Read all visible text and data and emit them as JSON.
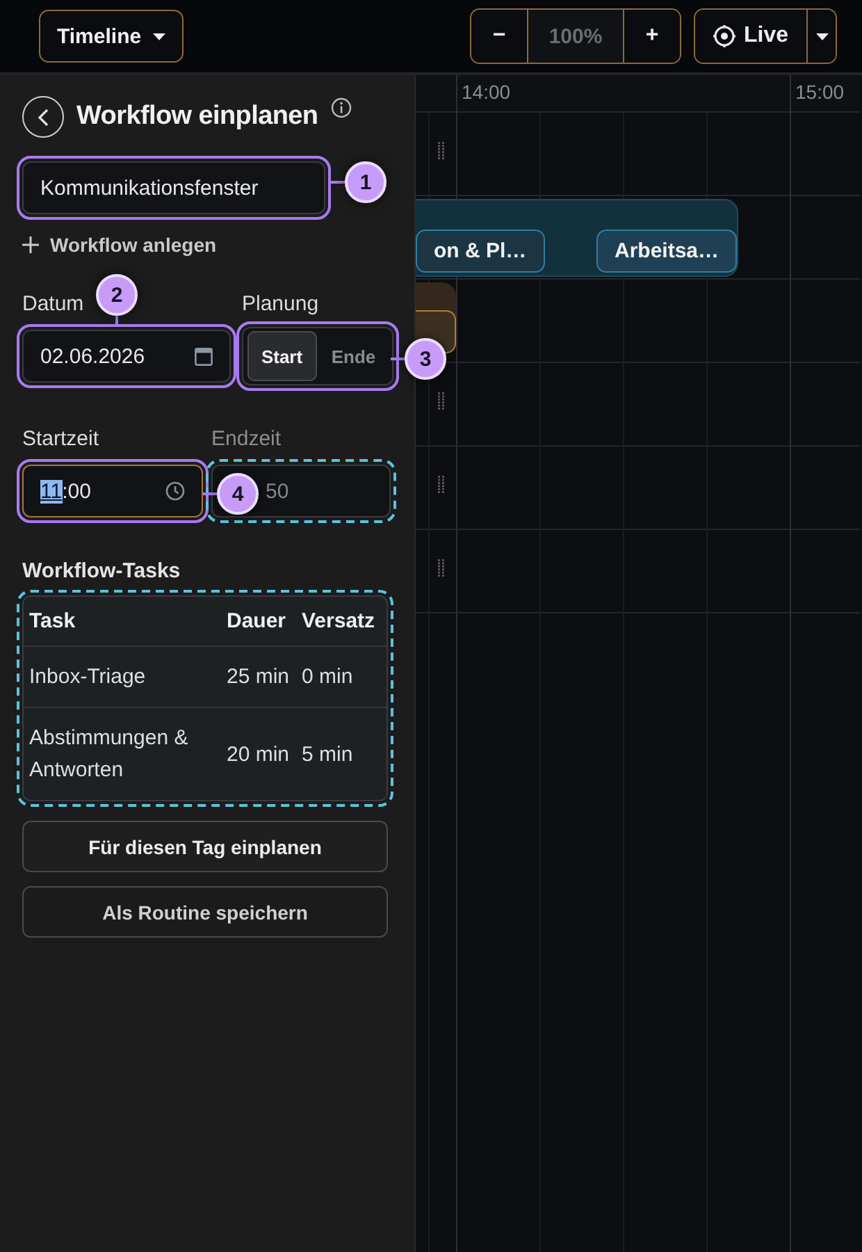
{
  "toolbar": {
    "view_menu": "Timeline",
    "zoom_out": "−",
    "zoom_level": "100%",
    "zoom_in": "+",
    "live_button": "Live"
  },
  "timeline": {
    "hours": [
      "14:00",
      "15:00"
    ],
    "events": [
      {
        "label": "on & Pl…",
        "color": "#2f7ea3"
      },
      {
        "label": "Arbeitsa…",
        "color": "#2f7ea3"
      },
      {
        "color": "#b27a3a"
      }
    ]
  },
  "panel": {
    "title": "Workflow einplanen",
    "workflow_select": {
      "value": "Kommunikationsfenster"
    },
    "add_workflow": "Workflow anlegen",
    "date_label": "Datum",
    "date_field": {
      "value": "02.06.2026"
    },
    "planning_label": "Planung",
    "planning_options": [
      {
        "label": "Start",
        "selected": true
      },
      {
        "label": "Ende",
        "selected": false
      }
    ],
    "start_label": "Startzeit",
    "start_field": {
      "value_parts": [
        {
          "text": "11",
          "selected": true
        },
        {
          "text": ":00",
          "selected": false
        }
      ]
    },
    "end_label": "Endzeit",
    "end_field": {
      "value": "50"
    },
    "tasks_title": "Workflow-Tasks",
    "tasks_table": {
      "columns": [
        "Task",
        "Dauer",
        "Versatz"
      ],
      "rows": [
        [
          "Inbox-Triage",
          "25 min",
          "0 min"
        ],
        [
          "Abstimmungen & Antworten",
          "20 min",
          "5 min"
        ]
      ]
    },
    "buttons": [
      "Für diesen Tag einplanen",
      "Als Routine speichern"
    ]
  },
  "callouts": [
    "1",
    "2",
    "3",
    "4"
  ]
}
